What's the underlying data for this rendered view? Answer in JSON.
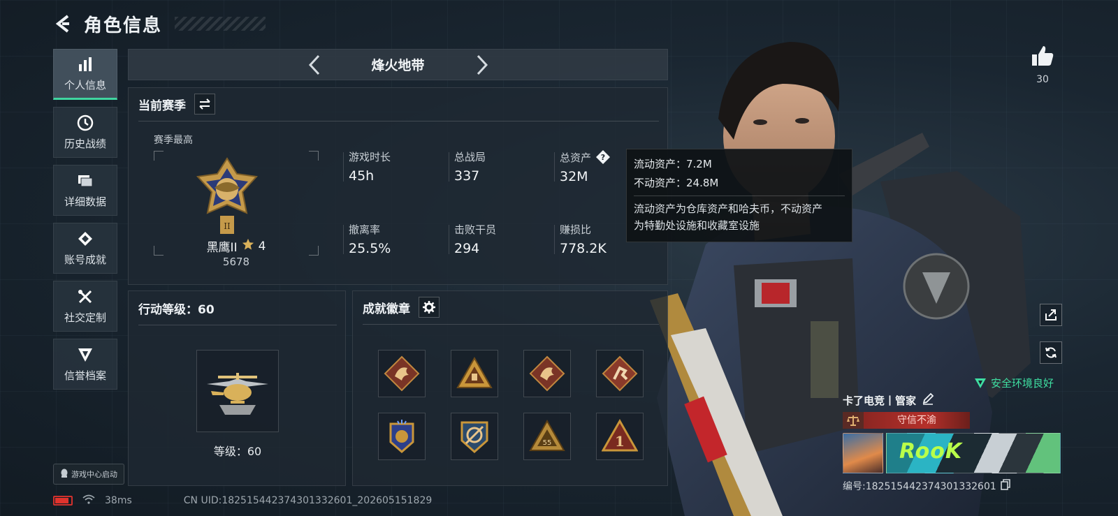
{
  "header": {
    "title": "角色信息"
  },
  "sidebar": {
    "items": [
      {
        "label": "个人信息",
        "icon": "bar-chart-icon",
        "active": true
      },
      {
        "label": "历史战绩",
        "icon": "clock-icon"
      },
      {
        "label": "详细数据",
        "icon": "folder-icon"
      },
      {
        "label": "账号成就",
        "icon": "medal-icon"
      },
      {
        "label": "社交定制",
        "icon": "tools-icon"
      },
      {
        "label": "信誉档案",
        "icon": "shield-icon"
      }
    ],
    "game_center": "游戏中心启动"
  },
  "mode": {
    "name": "烽火地带"
  },
  "season": {
    "title": "当前赛季",
    "sub": "赛季最高",
    "rank_name": "黑鹰II",
    "rank_stars": "4",
    "rank_score": "5678",
    "stats": [
      {
        "label": "游戏时长",
        "value": "45h"
      },
      {
        "label": "总战局",
        "value": "337"
      },
      {
        "label": "总资产",
        "value": "32M"
      },
      {
        "label": "撤离率",
        "value": "25.5%"
      },
      {
        "label": "击败干员",
        "value": "294"
      },
      {
        "label": "赚损比",
        "value": "778.2K"
      }
    ]
  },
  "tooltip": {
    "liquid": "流动资产：7.2M",
    "fixed": "不动资产：24.8M",
    "note_line1": "流动资产为仓库资产和哈夫币，不动资产",
    "note_line2": "为特勤处设施和收藏室设施"
  },
  "level": {
    "title": "行动等级：60",
    "text": "等级：60"
  },
  "achievements": {
    "title": "成就徽章",
    "medals": [
      "dragon-medal-icon",
      "pyramid-medal-icon",
      "dragon-medal-icon",
      "runner-medal-icon",
      "wings-medal-icon",
      "crosshair-medal-icon",
      "55-pyramid-medal-icon",
      "rank-1-medal-icon"
    ]
  },
  "right": {
    "like_count": "30",
    "safe_status": "安全环境良好"
  },
  "profile": {
    "name": "卡了电竞丨管家",
    "motto": "守信不渝",
    "banner_text": "RooK",
    "id": "编号:1825154423743013326​01"
  },
  "footer": {
    "ping": "38ms",
    "uid": "CN UID:182515442374301332601_202605151829"
  },
  "colors": {
    "accent": "#3fd6a0",
    "safe": "#3fe0a2",
    "battery": "#e0332d",
    "motto": "#b5302a"
  },
  "battery_level": 0.85
}
